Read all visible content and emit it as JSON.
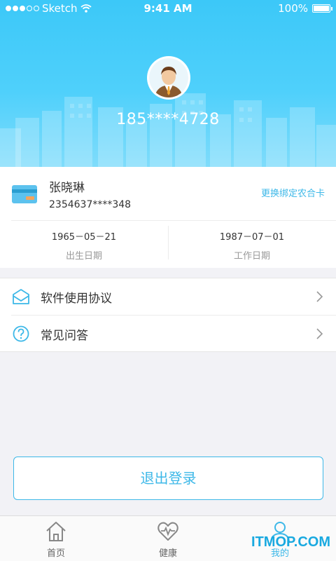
{
  "status_bar": {
    "carrier": "Sketch",
    "time": "9:41 AM",
    "battery": "100%"
  },
  "profile": {
    "phone": "185****4728"
  },
  "card": {
    "holder_name": "张晓琳",
    "number": "2354637****348",
    "rebind_label": "更换绑定农合卡",
    "birth_date": "1965－05－21",
    "birth_label": "出生日期",
    "work_date": "1987－07－01",
    "work_label": "工作日期"
  },
  "menu": {
    "items": [
      {
        "label": "软件使用协议",
        "icon": "envelope-icon"
      },
      {
        "label": "常见问答",
        "icon": "question-icon"
      }
    ]
  },
  "logout_label": "退出登录",
  "tabbar": {
    "tabs": [
      {
        "label": "首页",
        "icon": "home-icon"
      },
      {
        "label": "健康",
        "icon": "heart-pulse-icon"
      },
      {
        "label": "我的",
        "icon": "person-icon"
      }
    ],
    "active": "我的"
  },
  "watermark": "ITMOP.COM",
  "colors": {
    "accent": "#3db8e8",
    "header": "#4fd0fb"
  }
}
